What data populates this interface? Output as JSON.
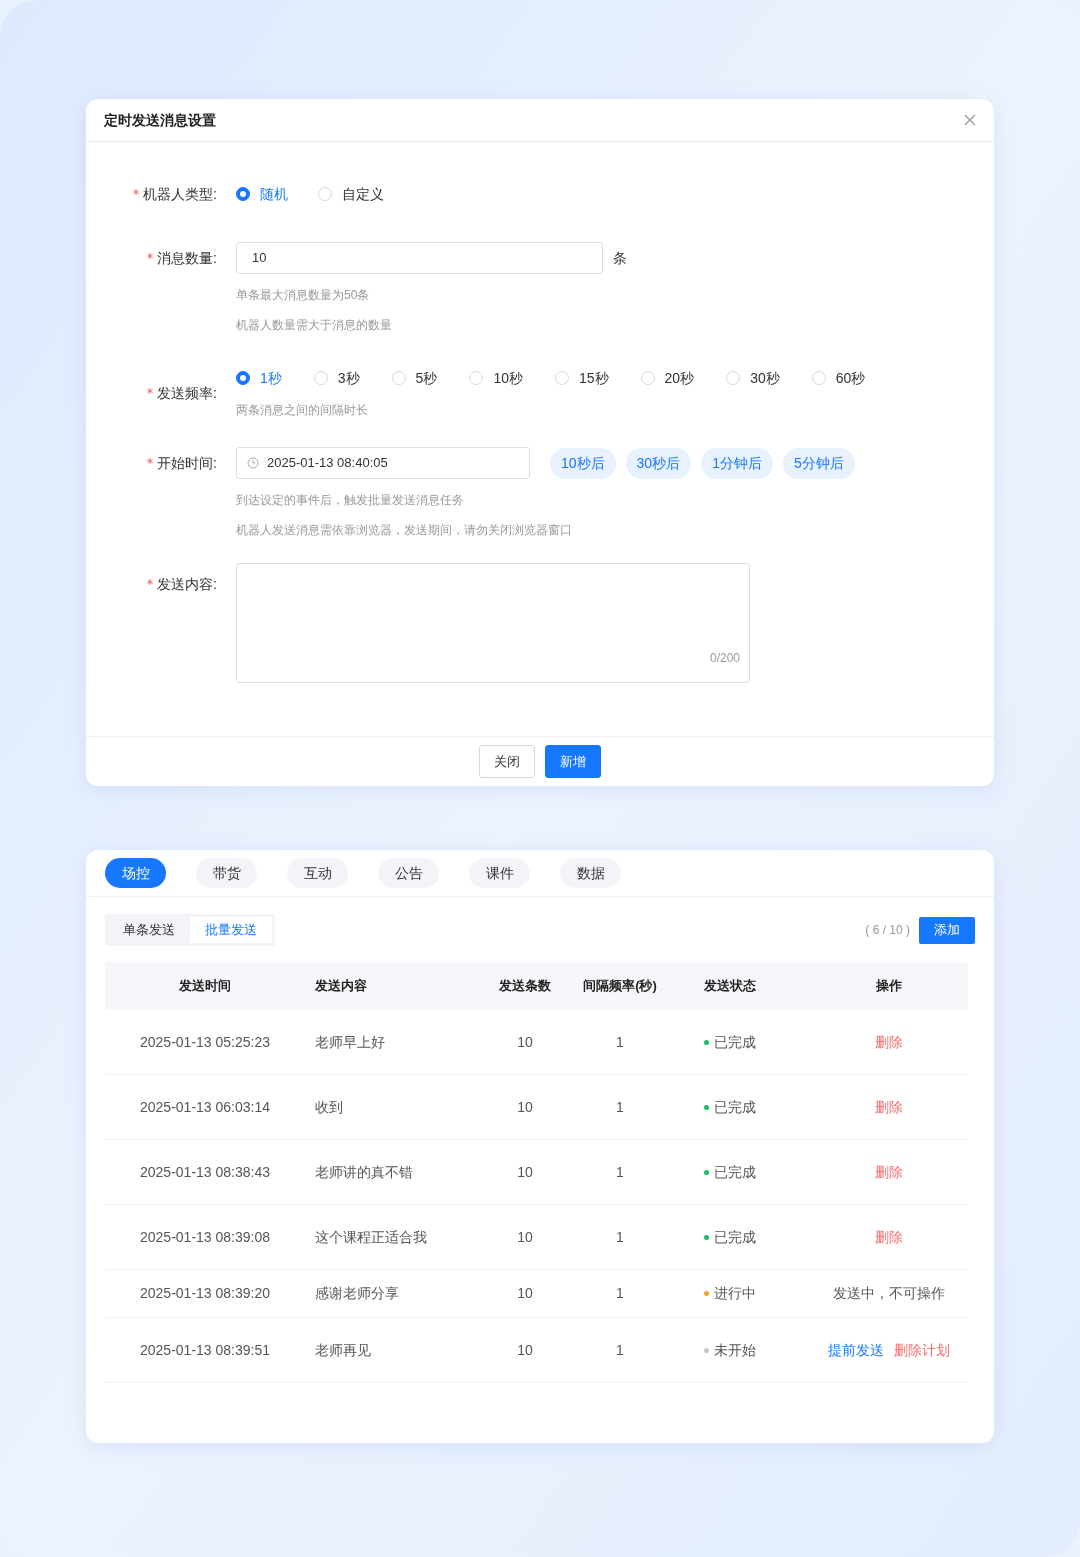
{
  "dialog": {
    "title": "定时发送消息设置",
    "robot_type": {
      "label": "机器人类型:",
      "required": true,
      "options": [
        {
          "label": "随机",
          "selected": true
        },
        {
          "label": "自定义",
          "selected": false
        }
      ]
    },
    "message_count": {
      "label": "消息数量:",
      "required": true,
      "value": "10",
      "unit": "条",
      "hints": [
        "单条最大消息数量为50条",
        "机器人数量需大于消息的数量"
      ]
    },
    "frequency": {
      "label": "发送频率:",
      "required": true,
      "options": [
        {
          "label": "1秒",
          "selected": true
        },
        {
          "label": "3秒",
          "selected": false
        },
        {
          "label": "5秒",
          "selected": false
        },
        {
          "label": "10秒",
          "selected": false
        },
        {
          "label": "15秒",
          "selected": false
        },
        {
          "label": "20秒",
          "selected": false
        },
        {
          "label": "30秒",
          "selected": false
        },
        {
          "label": "60秒",
          "selected": false
        }
      ],
      "hints": [
        "两条消息之间的间隔时长"
      ]
    },
    "start_time": {
      "label": "开始时间:",
      "required": true,
      "value": "2025-01-13 08:40:05",
      "quick_picks": [
        "10秒后",
        "30秒后",
        "1分钟后",
        "5分钟后"
      ],
      "hints": [
        "到达设定的事件后，触发批量发送消息任务",
        "机器人发送消息需依靠浏览器，发送期间，请勿关闭浏览器窗口"
      ]
    },
    "content": {
      "label": "发送内容:",
      "required": true,
      "counter": "0/200"
    },
    "buttons": [
      {
        "label": "关闭",
        "kind": "default"
      },
      {
        "label": "新增",
        "kind": "primary"
      }
    ]
  },
  "panel": {
    "tabs": [
      {
        "label": "场控",
        "selected": true
      },
      {
        "label": "带货",
        "selected": false
      },
      {
        "label": "互动",
        "selected": false
      },
      {
        "label": "公告",
        "selected": false
      },
      {
        "label": "课件",
        "selected": false
      },
      {
        "label": "数据",
        "selected": false
      }
    ],
    "sub_tabs": [
      {
        "label": "单条发送",
        "selected": false
      },
      {
        "label": "批量发送",
        "selected": true
      }
    ],
    "count": "( 6 / 10 )",
    "add_button": "添加",
    "table": {
      "columns": [
        "发送时间",
        "发送内容",
        "发送条数",
        "间隔频率(秒)",
        "发送状态",
        "操作"
      ],
      "rows": [
        {
          "time": "2025-01-13 05:25:23",
          "content": "老师早上好",
          "count": "10",
          "interval": "1",
          "status": "已完成",
          "color": "#19be6b",
          "actions": [
            {
              "label": "删除",
              "kind": "danger"
            }
          ]
        },
        {
          "time": "2025-01-13 06:03:14",
          "content": "收到",
          "count": "10",
          "interval": "1",
          "status": "已完成",
          "color": "#19be6b",
          "actions": [
            {
              "label": "删除",
              "kind": "danger"
            }
          ]
        },
        {
          "time": "2025-01-13 08:38:43",
          "content": "老师讲的真不错",
          "count": "10",
          "interval": "1",
          "status": "已完成",
          "color": "#19be6b",
          "actions": [
            {
              "label": "删除",
              "kind": "danger"
            }
          ]
        },
        {
          "time": "2025-01-13 08:39:08",
          "content": "这个课程正适合我",
          "count": "10",
          "interval": "1",
          "status": "已完成",
          "color": "#19be6b",
          "actions": [
            {
              "label": "删除",
              "kind": "danger"
            }
          ]
        },
        {
          "time": "2025-01-13 08:39:20",
          "content": "感谢老师分享",
          "count": "10",
          "interval": "1",
          "status": "进行中",
          "color": "#f5a623",
          "actions": [
            {
              "label": "发送中，不可操作",
              "kind": "text"
            }
          ]
        },
        {
          "time": "2025-01-13 08:39:51",
          "content": "老师再见",
          "count": "10",
          "interval": "1",
          "status": "未开始",
          "color": "#c8c8c8",
          "actions": [
            {
              "label": "提前发送",
              "kind": "link"
            },
            {
              "label": "删除计划",
              "kind": "danger"
            }
          ]
        }
      ]
    }
  }
}
